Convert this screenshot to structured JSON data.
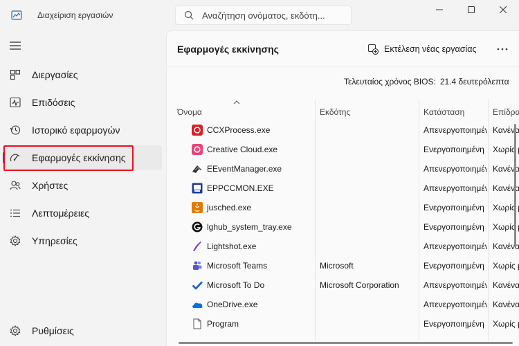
{
  "window": {
    "title": "Διαχείριση εργασιών"
  },
  "search": {
    "placeholder": "Αναζήτηση ονόματος, εκδότη..."
  },
  "sidebar": {
    "items": [
      {
        "label": "Διεργασίες",
        "icon": "processes-icon"
      },
      {
        "label": "Επιδόσεις",
        "icon": "performance-icon"
      },
      {
        "label": "Ιστορικό εφαρμογών",
        "icon": "app-history-icon"
      },
      {
        "label": "Εφαρμογές εκκίνησης",
        "icon": "startup-apps-icon",
        "active": true
      },
      {
        "label": "Χρήστες",
        "icon": "users-icon"
      },
      {
        "label": "Λεπτομέρειες",
        "icon": "details-icon"
      },
      {
        "label": "Υπηρεσίες",
        "icon": "services-icon"
      }
    ],
    "settings_label": "Ρυθμίσεις"
  },
  "main": {
    "title": "Εφαρμογές εκκίνησης",
    "run_task_label": "Εκτέλεση νέας εργασίας",
    "bios_label": "Τελευταίος χρόνος BIOS:",
    "bios_value": "21.4 δευτερόλεπτα",
    "columns": [
      "Όνομα",
      "Εκδότης",
      "Κατάσταση",
      "Επίδραση"
    ],
    "rows": [
      {
        "name": "CCXProcess.exe",
        "publisher": "",
        "status": "Απενεργοποιημένη",
        "impact": "Κανένα",
        "icon": "ccx-icon"
      },
      {
        "name": "Creative Cloud.exe",
        "publisher": "",
        "status": "Ενεργοποιημένη",
        "impact": "Χωρίς μέτρηση",
        "icon": "creative-cloud-icon"
      },
      {
        "name": "EEventManager.exe",
        "publisher": "",
        "status": "Απενεργοποιημένη",
        "impact": "Κανένα",
        "icon": "event-manager-icon"
      },
      {
        "name": "EPPCCMON.EXE",
        "publisher": "",
        "status": "Απενεργοποιημένη",
        "impact": "Κανένα",
        "icon": "eppccmon-icon"
      },
      {
        "name": "jusched.exe",
        "publisher": "",
        "status": "Ενεργοποιημένη",
        "impact": "Χωρίς μέτρηση",
        "icon": "java-icon"
      },
      {
        "name": "lghub_system_tray.exe",
        "publisher": "",
        "status": "Ενεργοποιημένη",
        "impact": "Χωρίς μέτρηση",
        "icon": "logitech-icon"
      },
      {
        "name": "Lightshot.exe",
        "publisher": "",
        "status": "Απενεργοποιημένη",
        "impact": "Κανένα",
        "icon": "lightshot-icon"
      },
      {
        "name": "Microsoft Teams",
        "publisher": "Microsoft",
        "status": "Ενεργοποιημένη",
        "impact": "Χωρίς μέτρηση",
        "icon": "teams-icon"
      },
      {
        "name": "Microsoft To Do",
        "publisher": "Microsoft Corporation",
        "status": "Απενεργοποιημένη",
        "impact": "Κανένα",
        "icon": "todo-icon"
      },
      {
        "name": "OneDrive.exe",
        "publisher": "",
        "status": "Απενεργοποιημένη",
        "impact": "Κανένα",
        "icon": "onedrive-icon"
      },
      {
        "name": "Program",
        "publisher": "",
        "status": "Ενεργοποιημένη",
        "impact": "Χωρίς μέτρηση",
        "icon": "file-icon"
      }
    ]
  },
  "colors": {
    "accent": "#005fb8",
    "highlight": "#e81123"
  }
}
